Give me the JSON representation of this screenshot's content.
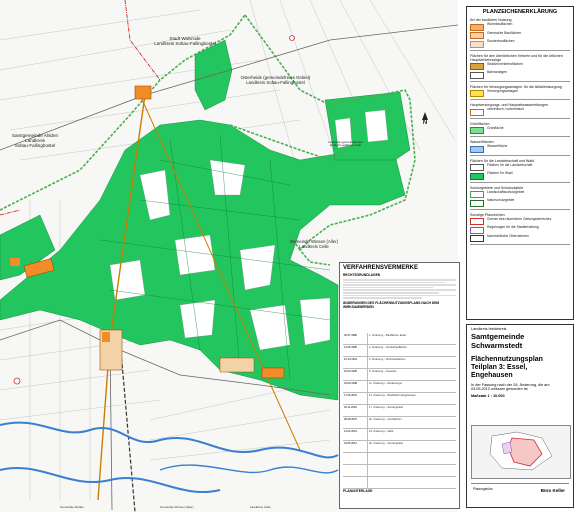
{
  "map": {
    "labels": {
      "stadt_walsrode_line1": "Stadt Walsrode",
      "stadt_walsrode_line2": "Landkreis Soltau-Fallingbostel",
      "osterheide_line1": "Osterheide (gemeindefreies Gebiet)",
      "osterheide_line2": "Landkreis Soltau-Fallingbostel",
      "ahlden_line1": "Samtgemeinde Ahlden",
      "ahlden_line2": "Landkreis",
      "ahlden_line3": "Soltau-Fallingbostel",
      "lohheide_line1": "Lohheide (gemeindefreies",
      "lohheide_line2": "Gebiet) Landkreis Celle",
      "winsen_line1": "Gemeinde Winsen (Aller)",
      "winsen_line2": "Landkreis Celle",
      "north_arrow": "N"
    },
    "bottom_labels": [
      "Gemeinde Ahlden",
      "Gemeinde Winsen (Aller)",
      "Landkreis Celle"
    ]
  },
  "legend": {
    "title": "PLANZEICHENERKLÄRUNG",
    "sections": [
      {
        "head": "Art der baulichen Nutzung",
        "items": [
          {
            "color": "#f2b06b",
            "border": "#c86a1e",
            "text": "Wohnbauflächen"
          },
          {
            "color": "#f4d2a8",
            "border": "#c86a1e",
            "text": "Gemischte Bauflächen"
          },
          {
            "color": "#f5e0c7",
            "border": "#999999",
            "text": "Sonderbauflächen"
          }
        ]
      },
      {
        "head": "Flächen für den überörtlichen Verkehr und für die örtlichen Hauptverkehrszüge",
        "items": [
          {
            "color": "#d9a23a",
            "border": "#8a5a10",
            "text": "Straßenverkehrsflächen"
          },
          {
            "color": "#ffffff",
            "border": "#555555",
            "text": "Bahnanlagen"
          }
        ]
      },
      {
        "head": "Flächen für Versorgungsanlagen, für die Abfallentsorgung",
        "items": [
          {
            "color": "#ffe14d",
            "border": "#b08a00",
            "text": "Versorgungsanlagen"
          }
        ]
      },
      {
        "head": "Hauptversorgungs- und Hauptabwasserleitungen",
        "items": [
          {
            "color": "#ffffff",
            "border": "#c86a1e",
            "text": "oberirdisch / unterirdisch"
          }
        ]
      },
      {
        "head": "Grünflächen",
        "items": [
          {
            "color": "#7ddf8f",
            "border": "#2a8a3a",
            "text": "Grünfläche"
          }
        ]
      },
      {
        "head": "Wasserflächen",
        "items": [
          {
            "color": "#9fc9f0",
            "border": "#3a6fa8",
            "text": "Wasserfläche"
          }
        ]
      },
      {
        "head": "Flächen für die Landwirtschaft und Wald",
        "items": [
          {
            "color": "#ffffff",
            "border": "#555555",
            "text": "Flächen für die Landwirtschaft"
          },
          {
            "color": "#22c55e",
            "border": "#0f7a36",
            "text": "Flächen für Wald"
          }
        ]
      },
      {
        "head": "Schutzgebiete und Schutzobjekte",
        "items": [
          {
            "color": "#ffffff",
            "border": "#3aa84a",
            "text": "Landschaftsschutzgebiet"
          },
          {
            "color": "#ffffff",
            "border": "#1f6e2e",
            "text": "Naturschutzgebiet"
          }
        ]
      },
      {
        "head": "Sonstige Planzeichen",
        "items": [
          {
            "color": "#ffffff",
            "border": "#d12b2b",
            "text": "Grenze des räumlichen Geltungsbereiches"
          },
          {
            "color": "#ffffff",
            "border": "#9a4fbf",
            "text": "Regelungen für die Stadterhaltung"
          },
          {
            "color": "#ffffff",
            "border": "#333333",
            "text": "Nachrichtliche Übernahmen"
          }
        ]
      }
    ]
  },
  "titleblock": {
    "county": "Landkreis Heidekreis",
    "municipality": "Samtgemeinde Schwarmstedt",
    "plan_title_line1": "Flächennutzungsplan",
    "plan_title_line2": "Teilplan 3: Essel, Engehausen",
    "note_line1": "In der Fassung nach der 26. Änderung, die am",
    "note_line2": "03.05.2012 wirksam geworden ist",
    "scale": "Maßstab 1 : 10.000",
    "firm_name": "Büro Keller",
    "firm_text": "Planungsbüro"
  },
  "proc": {
    "title": "VERFAHRENSVERMERKE",
    "subtitle1": "RECHTSGRUNDLAGEN",
    "subtitle2": "ÄNDERUNGEN DES FLÄCHENNUTZUNGSPLANS NACH DEM WIRKSAMWERDEN",
    "footer": "PLANUNTERLAGE",
    "rows": [
      {
        "date": "02.07.1980",
        "text": "1. Änderung – Bauflächen Essel"
      },
      {
        "date": "14.05.1985",
        "text": "2. Änderung – Sonderbauflächen"
      },
      {
        "date": "10.10.1991",
        "text": "5. Änderung – Wohnbauflächen"
      },
      {
        "date": "22.03.1995",
        "text": "8. Änderung – Gewerbe"
      },
      {
        "date": "04.09.1998",
        "text": "11. Änderung – Windenergie"
      },
      {
        "date": "17.06.2001",
        "text": "14. Änderung – Bauflächen Engehausen"
      },
      {
        "date": "30.11.2004",
        "text": "17. Änderung – Sondergebiet"
      },
      {
        "date": "08.08.2007",
        "text": "20. Änderung – Grünflächen"
      },
      {
        "date": "12.02.2010",
        "text": "23. Änderung – Wald"
      },
      {
        "date": "03.05.2012",
        "text": "26. Änderung – Sondergebiet"
      },
      {
        "date": "",
        "text": ""
      },
      {
        "date": "",
        "text": ""
      },
      {
        "date": "",
        "text": ""
      }
    ]
  },
  "colors": {
    "forest": "#22c55e",
    "forest_dark": "#14a84a",
    "boundary_green": "#4caf50",
    "boundary_red": "#d12b2b",
    "settlement": "#f28c28",
    "road": "#d9a23a",
    "river": "#3b7fd0",
    "powerline": "#c87f00"
  }
}
